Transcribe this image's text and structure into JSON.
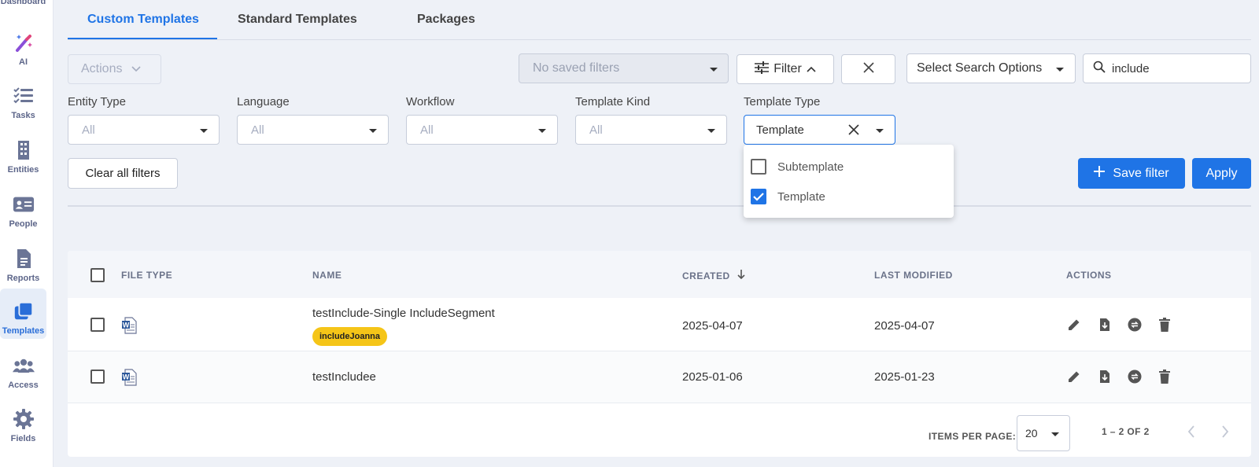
{
  "sidebar": {
    "dashboard_label": "Dashboard",
    "items": [
      {
        "label": "AI",
        "icon": "magic-wand-icon"
      },
      {
        "label": "Tasks",
        "icon": "checklist-icon"
      },
      {
        "label": "Entities",
        "icon": "building-icon"
      },
      {
        "label": "People",
        "icon": "id-card-icon"
      },
      {
        "label": "Reports",
        "icon": "document-icon"
      },
      {
        "label": "Templates",
        "icon": "stacked-pages-icon"
      },
      {
        "label": "Access",
        "icon": "users-group-icon"
      },
      {
        "label": "Fields",
        "icon": "gear-icon"
      }
    ],
    "active": "Templates"
  },
  "tabs": [
    {
      "label": "Custom Templates",
      "active": true
    },
    {
      "label": "Standard Templates",
      "active": false
    },
    {
      "label": "Packages",
      "active": false
    }
  ],
  "toolbar": {
    "actions_label": "Actions",
    "saved_filters_placeholder": "No saved filters",
    "filter_label": "Filter",
    "search_options_label": "Select Search Options",
    "search_value": "include"
  },
  "filters": {
    "entity_type": {
      "label": "Entity Type",
      "value": "All"
    },
    "language": {
      "label": "Language",
      "value": "All"
    },
    "workflow": {
      "label": "Workflow",
      "value": "All"
    },
    "template_kind": {
      "label": "Template Kind",
      "value": "All"
    },
    "template_type": {
      "label": "Template Type",
      "value": "Template"
    },
    "clear_all_label": "Clear all filters",
    "save_filter_label": "Save filter",
    "apply_label": "Apply"
  },
  "template_type_menu": [
    {
      "label": "Subtemplate",
      "checked": false
    },
    {
      "label": "Template",
      "checked": true
    }
  ],
  "table": {
    "headers": {
      "file_type": "FILE TYPE",
      "name": "NAME",
      "created": "CREATED",
      "last_modified": "LAST MODIFIED",
      "actions": "ACTIONS"
    },
    "rows": [
      {
        "file_type": "word-document-icon",
        "name": "testInclude-Single IncludeSegment",
        "tag": "includeJoanna",
        "created": "2025-04-07",
        "last_modified": "2025-04-07"
      },
      {
        "file_type": "word-document-icon",
        "name": "testIncludee",
        "tag": "",
        "created": "2025-01-06",
        "last_modified": "2025-01-23"
      }
    ]
  },
  "pagination": {
    "items_per_page_label": "ITEMS PER PAGE:",
    "items_per_page": "20",
    "range": "1 – 2 OF 2"
  },
  "colors": {
    "accent": "#1f74e6",
    "tag": "#f5c518",
    "sidebar_active_bg": "#e6edf8"
  }
}
